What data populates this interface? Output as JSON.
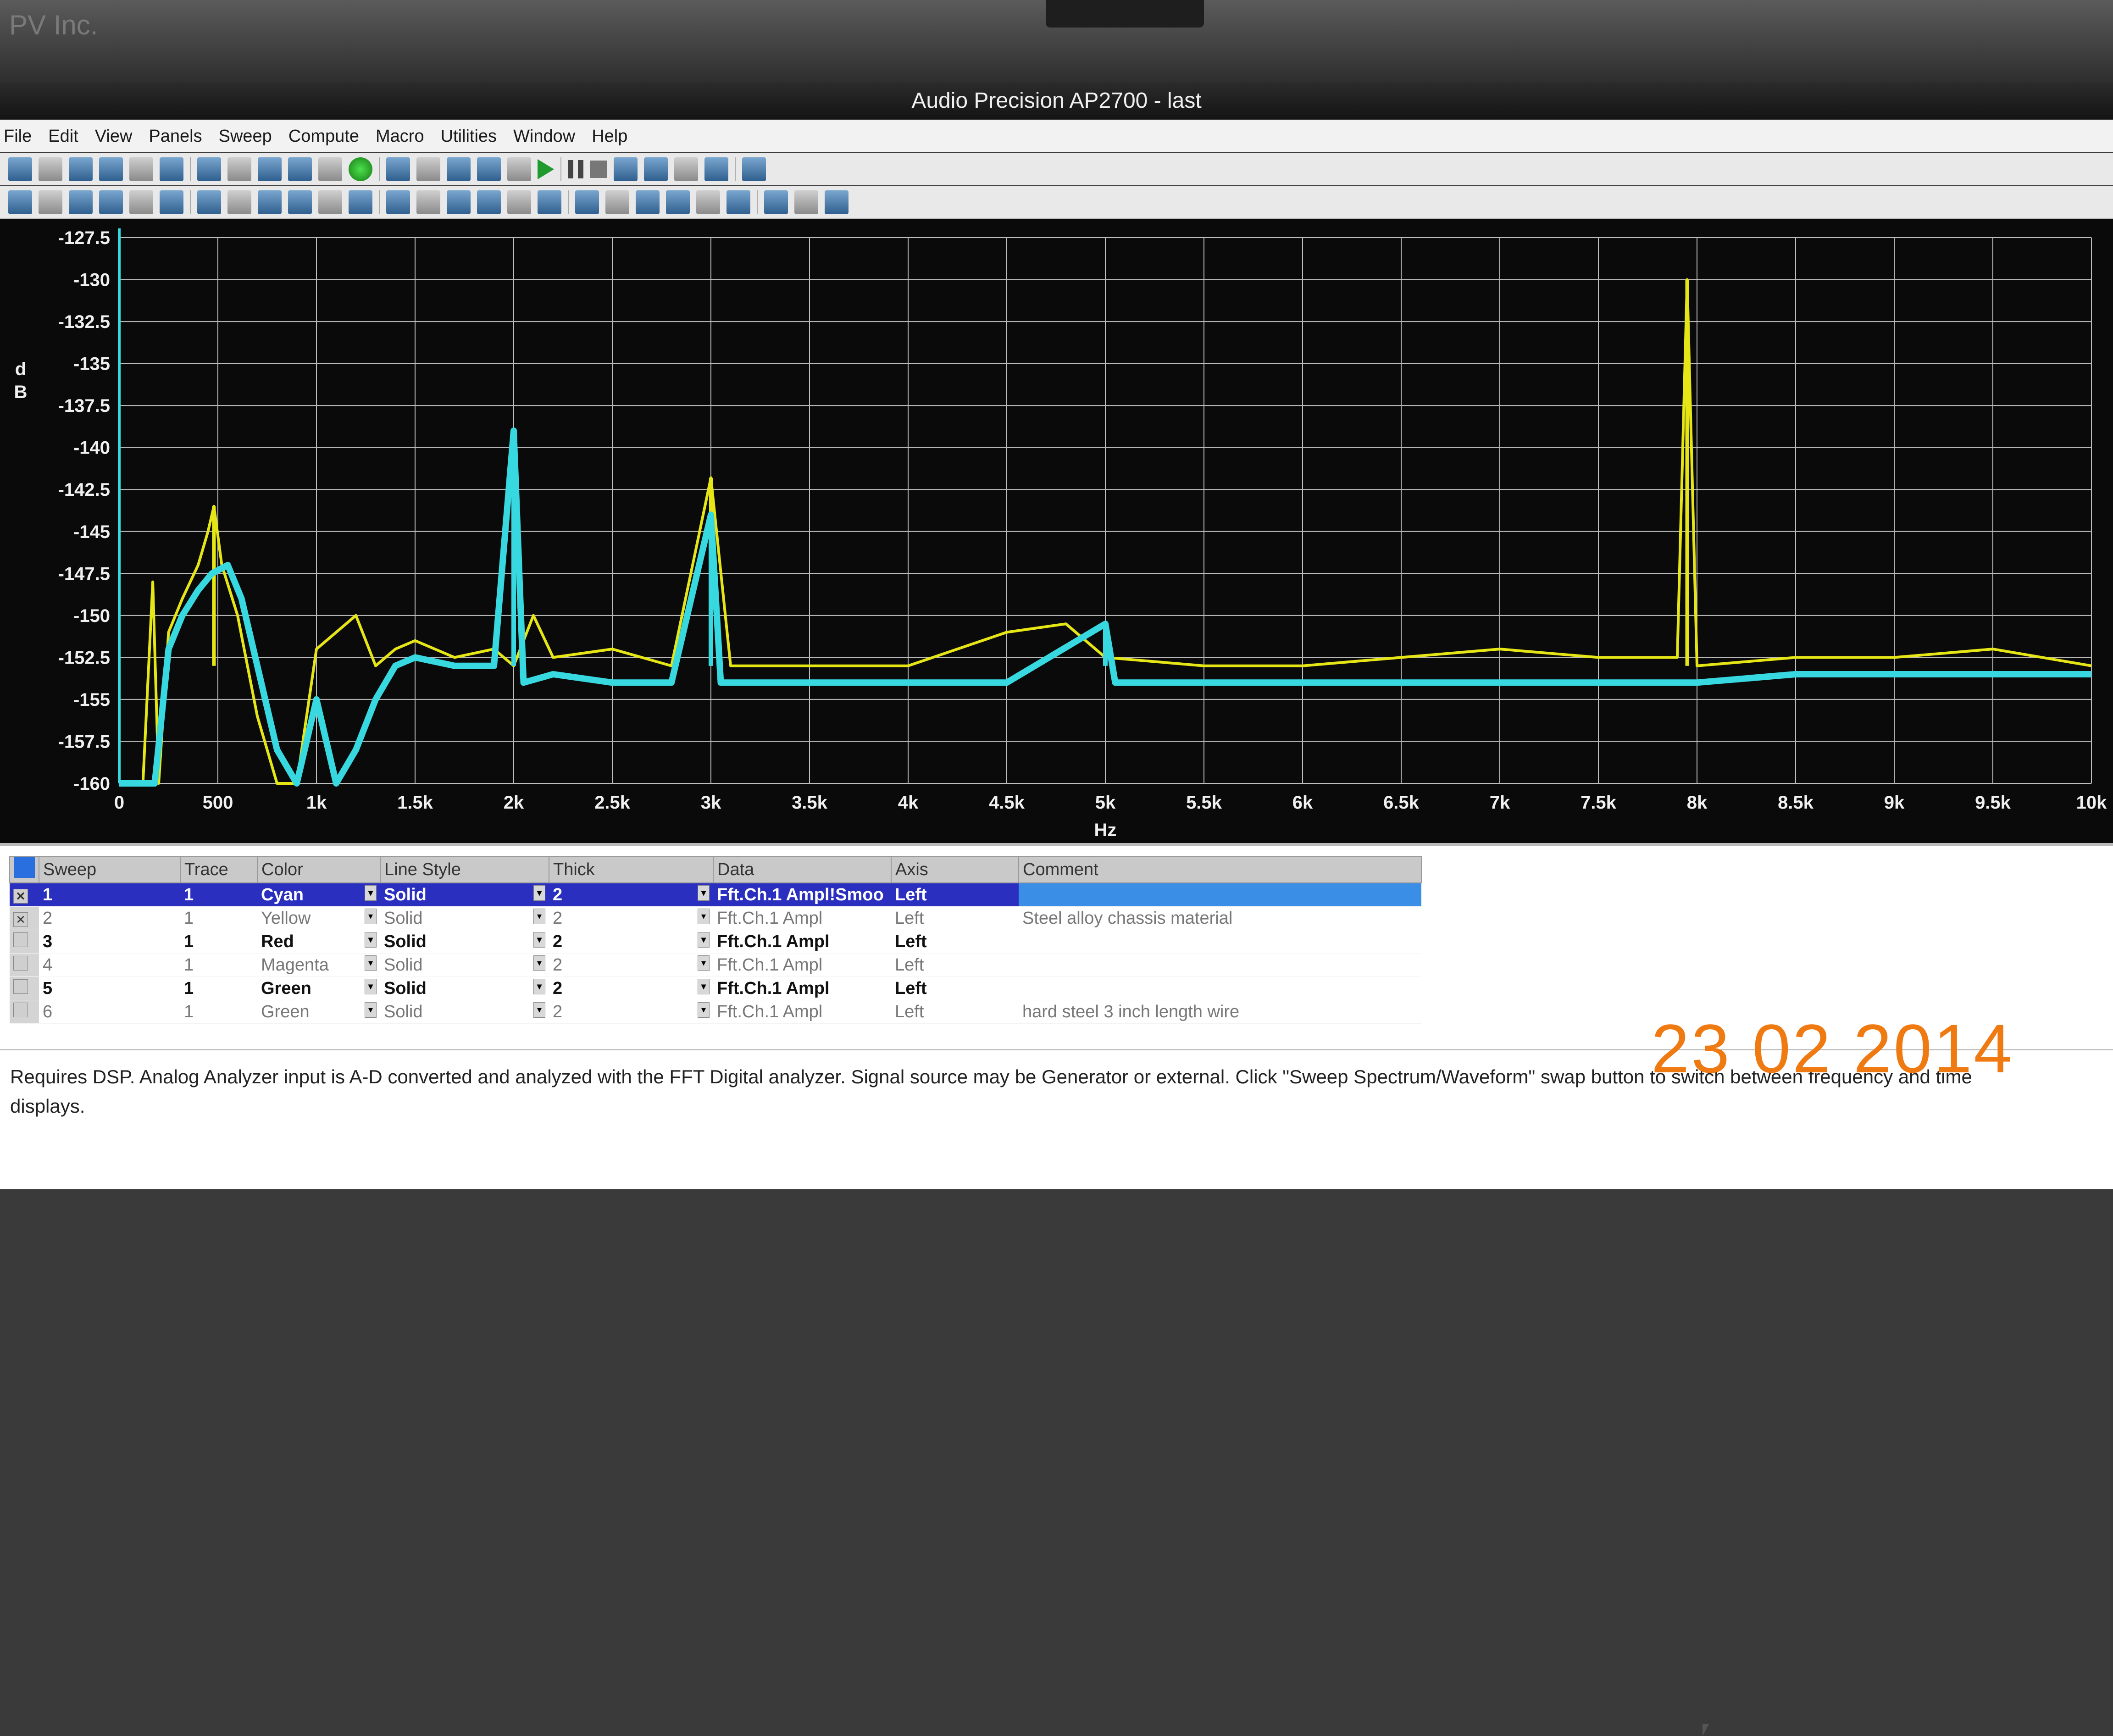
{
  "bezel": {
    "brand": "PV Inc."
  },
  "window": {
    "title": "Audio Precision AP2700 - last"
  },
  "menu": [
    "File",
    "Edit",
    "View",
    "Panels",
    "Sweep",
    "Compute",
    "Macro",
    "Utilities",
    "Window",
    "Help"
  ],
  "toolbar": {
    "row1_icons": [
      "new-icon",
      "open-icon",
      "open-folder-icon",
      "save-icon",
      "save-all-icon",
      "print-icon",
      "print-preview-icon",
      "undo-icon",
      "cut-icon",
      "copy-icon",
      "paste-icon",
      "go-icon",
      "stop-circle-icon",
      "graph-icon",
      "tool-a-icon",
      "tool-b-icon",
      "panel-icon",
      "play-icon",
      "pause-icon",
      "stop-icon",
      "hand-icon",
      "link-icon",
      "move-icon",
      "zoom-in-icon",
      "zoom-out-icon"
    ],
    "row2_icons": [
      "analyzer-icon",
      "generator-icon",
      "sweep-icon",
      "dsp-icon",
      "switch-icon",
      "filter-icon",
      "bargraph-icon",
      "meter-icon",
      "speaker-icon",
      "dcx-icon",
      "check-icon",
      "bar-a-icon",
      "bar-b-icon",
      "arrow-right-icon",
      "arrow-down-icon",
      "chart-icon",
      "panel-b-icon",
      "calc-icon",
      "tree-icon",
      "note-icon",
      "view-a-icon",
      "view-b-icon",
      "view-c-icon",
      "view-d-icon",
      "view-e-icon",
      "view-f-icon",
      "view-g-icon"
    ]
  },
  "chart_data": {
    "type": "line",
    "title": "",
    "xlabel": "Hz",
    "ylabel": "d\nB",
    "xlim": [
      0,
      10000
    ],
    "ylim": [
      -160,
      -127.5
    ],
    "x_ticks": [
      "0",
      "500",
      "1k",
      "1.5k",
      "2k",
      "2.5k",
      "3k",
      "3.5k",
      "4k",
      "4.5k",
      "5k",
      "5.5k",
      "6k",
      "6.5k",
      "7k",
      "7.5k",
      "8k",
      "8.5k",
      "9k",
      "9.5k",
      "10k"
    ],
    "y_ticks": [
      "-127.5",
      "-130",
      "-132.5",
      "-135",
      "-137.5",
      "-140",
      "-142.5",
      "-145",
      "-147.5",
      "-150",
      "-152.5",
      "-155",
      "-157.5",
      "-160"
    ],
    "grid": true,
    "colors": {
      "background": "#0a0a0a",
      "grid": "#bdbdbd",
      "yellow": "#e6e616",
      "cyan": "#38d8e0"
    },
    "series": [
      {
        "name": "Yellow",
        "color": "#e6e616",
        "points": [
          [
            0,
            -160
          ],
          [
            120,
            -160
          ],
          [
            170,
            -148
          ],
          [
            200,
            -160
          ],
          [
            250,
            -151
          ],
          [
            320,
            -149
          ],
          [
            400,
            -147
          ],
          [
            450,
            -145
          ],
          [
            480,
            -143.5
          ],
          [
            520,
            -147
          ],
          [
            600,
            -150
          ],
          [
            700,
            -156
          ],
          [
            800,
            -160
          ],
          [
            900,
            -160
          ],
          [
            1000,
            -152
          ],
          [
            1100,
            -151
          ],
          [
            1200,
            -150
          ],
          [
            1300,
            -153
          ],
          [
            1400,
            -152
          ],
          [
            1500,
            -151.5
          ],
          [
            1700,
            -152.5
          ],
          [
            1900,
            -152
          ],
          [
            2000,
            -153
          ],
          [
            2100,
            -150
          ],
          [
            2200,
            -152.5
          ],
          [
            2500,
            -152
          ],
          [
            2800,
            -153
          ],
          [
            3000,
            -141.8
          ],
          [
            3100,
            -153
          ],
          [
            3500,
            -153
          ],
          [
            4000,
            -153
          ],
          [
            4500,
            -151
          ],
          [
            4800,
            -150.5
          ],
          [
            5000,
            -152.5
          ],
          [
            5500,
            -153
          ],
          [
            6000,
            -153
          ],
          [
            6500,
            -152.5
          ],
          [
            7000,
            -152
          ],
          [
            7500,
            -152.5
          ],
          [
            7900,
            -152.5
          ],
          [
            7950,
            -130
          ],
          [
            8000,
            -153
          ],
          [
            8500,
            -152.5
          ],
          [
            9000,
            -152.5
          ],
          [
            9500,
            -152
          ],
          [
            10000,
            -153
          ]
        ],
        "labeled_peaks": [
          {
            "x": 480,
            "y": -143.5
          },
          {
            "x": 3000,
            "y": -141.8
          },
          {
            "x": 7950,
            "y": -130
          }
        ]
      },
      {
        "name": "Cyan",
        "color": "#38d8e0",
        "points": [
          [
            0,
            -160
          ],
          [
            180,
            -160
          ],
          [
            250,
            -152
          ],
          [
            320,
            -150
          ],
          [
            400,
            -148.5
          ],
          [
            470,
            -147.5
          ],
          [
            550,
            -147
          ],
          [
            620,
            -149
          ],
          [
            700,
            -153
          ],
          [
            800,
            -158
          ],
          [
            900,
            -160
          ],
          [
            1000,
            -155
          ],
          [
            1100,
            -160
          ],
          [
            1200,
            -158
          ],
          [
            1300,
            -155
          ],
          [
            1400,
            -153
          ],
          [
            1500,
            -152.5
          ],
          [
            1700,
            -153
          ],
          [
            1900,
            -153
          ],
          [
            2000,
            -139
          ],
          [
            2050,
            -154
          ],
          [
            2200,
            -153.5
          ],
          [
            2500,
            -154
          ],
          [
            2800,
            -154
          ],
          [
            3000,
            -144
          ],
          [
            3050,
            -154
          ],
          [
            3500,
            -154
          ],
          [
            4000,
            -154
          ],
          [
            4500,
            -154
          ],
          [
            5000,
            -150.5
          ],
          [
            5050,
            -154
          ],
          [
            5500,
            -154
          ],
          [
            6000,
            -154
          ],
          [
            6500,
            -154
          ],
          [
            7000,
            -154
          ],
          [
            7500,
            -154
          ],
          [
            8000,
            -154
          ],
          [
            8500,
            -153.5
          ],
          [
            9000,
            -153.5
          ],
          [
            9500,
            -153.5
          ],
          [
            10000,
            -153.5
          ]
        ],
        "labeled_peaks": [
          {
            "x": 2000,
            "y": -139
          },
          {
            "x": 3000,
            "y": -144
          },
          {
            "x": 5000,
            "y": -150.5
          }
        ]
      }
    ]
  },
  "table": {
    "headers": [
      "Sweep",
      "Trace",
      "Color",
      "Line Style",
      "Thick",
      "Data",
      "Axis",
      "Comment"
    ],
    "rows": [
      {
        "sweep": "1",
        "trace": "1",
        "color": "Cyan",
        "style": "Solid",
        "thick": "2",
        "data": "Fft.Ch.1 Ampl!Smoo",
        "axis": "Left",
        "comment": "",
        "checked": false,
        "state": "selected"
      },
      {
        "sweep": "2",
        "trace": "1",
        "color": "Yellow",
        "style": "Solid",
        "thick": "2",
        "data": "Fft.Ch.1 Ampl",
        "axis": "Left",
        "comment": "Steel alloy chassis material",
        "checked": true,
        "state": "dim"
      },
      {
        "sweep": "3",
        "trace": "1",
        "color": "Red",
        "style": "Solid",
        "thick": "2",
        "data": "Fft.Ch.1 Ampl",
        "axis": "Left",
        "comment": "",
        "checked": false,
        "state": "bold"
      },
      {
        "sweep": "4",
        "trace": "1",
        "color": "Magenta",
        "style": "Solid",
        "thick": "2",
        "data": "Fft.Ch.1 Ampl",
        "axis": "Left",
        "comment": "",
        "checked": false,
        "state": "dim"
      },
      {
        "sweep": "5",
        "trace": "1",
        "color": "Green",
        "style": "Solid",
        "thick": "2",
        "data": "Fft.Ch.1 Ampl",
        "axis": "Left",
        "comment": "",
        "checked": false,
        "state": "bold"
      },
      {
        "sweep": "6",
        "trace": "1",
        "color": "Green",
        "style": "Solid",
        "thick": "2",
        "data": "Fft.Ch.1 Ampl",
        "axis": "Left",
        "comment": "hard steel 3 inch length wire",
        "checked": false,
        "state": "dim"
      }
    ]
  },
  "description": "Requires DSP.  Analog Analyzer input is A-D converted and analyzed with the FFT Digital analyzer.  Signal source may be Generator or external.  Click \"Sweep Spectrum/Waveform\" swap button to switch between frequency and time displays.",
  "date_stamp": "23 02 2014"
}
